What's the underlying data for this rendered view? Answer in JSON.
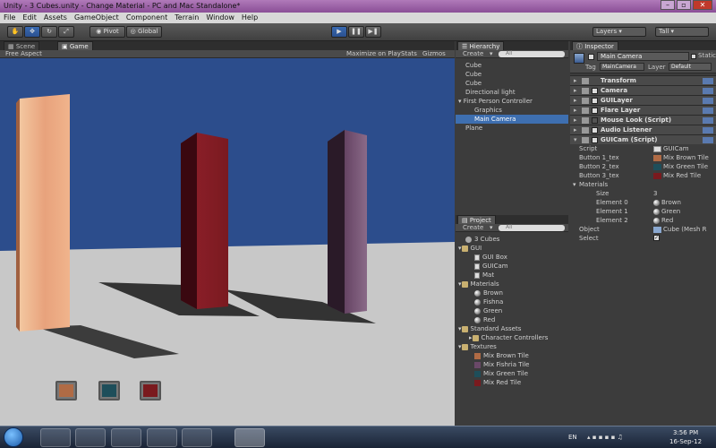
{
  "window": {
    "title": "Unity - 3 Cubes.unity - Change Material - PC and Mac Standalone*"
  },
  "menu": [
    "File",
    "Edit",
    "Assets",
    "GameObject",
    "Component",
    "Terrain",
    "Window",
    "Help"
  ],
  "toolbar": {
    "pivot_label": "Pivot",
    "global_label": "Global",
    "layers_label": "Layers",
    "layout_label": "Tall"
  },
  "scene_panel": {
    "tabs": [
      "Scene",
      "Game"
    ],
    "aspect_label": "Free Aspect",
    "maximize_label": "Maximize on Play",
    "stats_label": "Stats",
    "gizmos_label": "Gizmos"
  },
  "hierarchy": {
    "tab_label": "Hierarchy",
    "create_label": "Create",
    "search_placeholder": "All",
    "items": [
      {
        "label": "Cube",
        "indent": 0,
        "selected": false
      },
      {
        "label": "Cube",
        "indent": 0,
        "selected": false
      },
      {
        "label": "Cube",
        "indent": 0,
        "selected": false
      },
      {
        "label": "Directional light",
        "indent": 0,
        "selected": false
      },
      {
        "label": "First Person Controller",
        "indent": 0,
        "selected": false
      },
      {
        "label": "Graphics",
        "indent": 1,
        "selected": false
      },
      {
        "label": "Main Camera",
        "indent": 1,
        "selected": true
      },
      {
        "label": "Plane",
        "indent": 0,
        "selected": false
      }
    ]
  },
  "project": {
    "tab_label": "Project",
    "create_label": "Create",
    "search_placeholder": "All",
    "items": [
      {
        "label": "3 Cubes",
        "indent": 0,
        "icon": "unity"
      },
      {
        "label": "GUI",
        "indent": 0,
        "icon": "folder"
      },
      {
        "label": "GUI Box",
        "indent": 1,
        "icon": "doc"
      },
      {
        "label": "GUICam",
        "indent": 1,
        "icon": "doc"
      },
      {
        "label": "Mat",
        "indent": 1,
        "icon": "doc"
      },
      {
        "label": "Materials",
        "indent": 0,
        "icon": "folder"
      },
      {
        "label": "Brown",
        "indent": 1,
        "icon": "sphere"
      },
      {
        "label": "Fishna",
        "indent": 1,
        "icon": "sphere"
      },
      {
        "label": "Green",
        "indent": 1,
        "icon": "sphere"
      },
      {
        "label": "Red",
        "indent": 1,
        "icon": "sphere"
      },
      {
        "label": "Standard Assets",
        "indent": 0,
        "icon": "folder"
      },
      {
        "label": "Character Controllers",
        "indent": 1,
        "icon": "folder"
      },
      {
        "label": "Textures",
        "indent": 0,
        "icon": "folder"
      },
      {
        "label": "Mix Brown Tile",
        "indent": 1,
        "icon": "tex-brown"
      },
      {
        "label": "Mix Fishria Tile",
        "indent": 1,
        "icon": "tex-fishria"
      },
      {
        "label": "Mix Green Tile",
        "indent": 1,
        "icon": "tex-green"
      },
      {
        "label": "Mix Red Tile",
        "indent": 1,
        "icon": "tex-red"
      }
    ]
  },
  "inspector": {
    "tab_label": "Inspector",
    "object_name": "Main Camera",
    "static_label": "Static",
    "tag_label": "Tag",
    "tag_value": "MainCamera",
    "layer_label": "Layer",
    "layer_value": "Default",
    "components": [
      {
        "label": "Transform",
        "checkbox": false
      },
      {
        "label": "Camera",
        "checkbox": true
      },
      {
        "label": "GUILayer",
        "checkbox": true
      },
      {
        "label": "Flare Layer",
        "checkbox": true
      },
      {
        "label": "Mouse Look (Script)",
        "checkbox": false
      },
      {
        "label": "Audio Listener",
        "checkbox": true
      },
      {
        "label": "GUICam (Script)",
        "checkbox": true
      }
    ],
    "script_props": [
      {
        "label": "Script",
        "value": "GUICam",
        "icon": "doc"
      },
      {
        "label": "Button 1_tex",
        "value": "Mix Brown Tile",
        "icon": "tex-brown"
      },
      {
        "label": "Button 2_tex",
        "value": "Mix Green Tile",
        "icon": "tex-green"
      },
      {
        "label": "Button 3_tex",
        "value": "Mix Red Tile",
        "icon": "tex-red"
      }
    ],
    "materials_label": "Materials",
    "size_label": "Size",
    "size_value": "3",
    "elements": [
      {
        "label": "Element 0",
        "value": "Brown"
      },
      {
        "label": "Element 1",
        "value": "Green"
      },
      {
        "label": "Element 2",
        "value": "Red"
      }
    ],
    "object_label": "Object",
    "object_value": "Cube (Mesh R",
    "select_label": "Select"
  },
  "taskbar": {
    "language": "EN",
    "time": "3:56 PM",
    "date": "16-Sep-12"
  },
  "colors": {
    "accent": "#3e6fb0",
    "sky": "#2c4d8c",
    "ground": "#c8c8c8",
    "brown_tile": "#b06b45",
    "green_tile": "#1e4e5a",
    "red_tile": "#7a1a1e"
  }
}
